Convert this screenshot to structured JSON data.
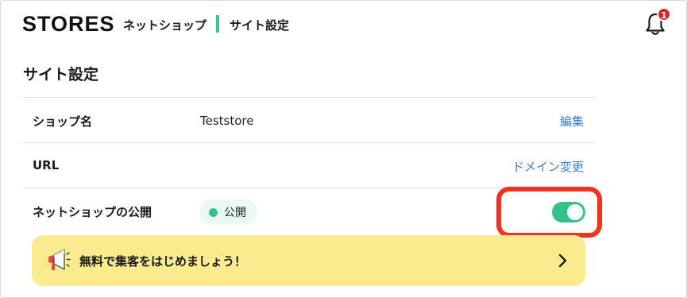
{
  "header": {
    "logo": "STORES",
    "breadcrumb": [
      "ネットショップ",
      "サイト設定"
    ],
    "notifications": {
      "icon": "bell-icon",
      "count": "1"
    }
  },
  "page": {
    "title": "サイト設定"
  },
  "rows": [
    {
      "label": "ショップ名",
      "value": "Teststore",
      "action": "編集"
    },
    {
      "label": "URL",
      "value": "",
      "action": "ドメイン変更"
    },
    {
      "label": "ネットショップの公開",
      "status": "公開",
      "toggle_on": true
    }
  ],
  "banner": {
    "icon": "megaphone-icon",
    "text": "無料で集客をはじめましょう！",
    "chevron": "chevron-right-icon"
  },
  "colors": {
    "accent": "#33c28a",
    "link": "#3d7bd6",
    "badge": "#d9252a",
    "banner": "#fbeb8f",
    "highlight": "#f2311e"
  }
}
